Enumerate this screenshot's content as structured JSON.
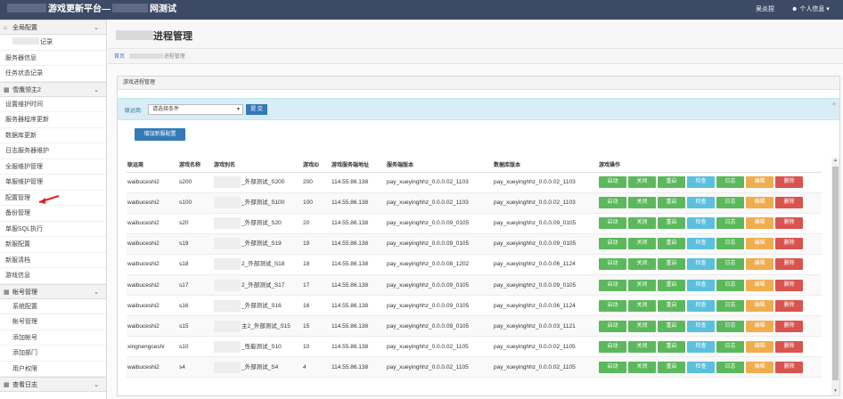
{
  "topbar": {
    "title_part1": "游戏更新平台—",
    "title_part2": "网测试",
    "user_name": "吴炎捏",
    "user_menu": "个人信息"
  },
  "sidebar": {
    "sections": [
      {
        "title": "全局配置",
        "icon": "home-icon",
        "items": [
          "记录",
          "服务器信息",
          "任务状态记录"
        ]
      },
      {
        "title": "雪鹰领主2",
        "icon": "grid-icon",
        "items": [
          "设置维护时间",
          "服务器程序更新",
          "数据库更新",
          "日志服务器维护",
          "全服维护管理",
          "单服维护管理",
          "配置管理",
          "备份管理",
          "单服SQL执行",
          "新服配置",
          "新服清档",
          "游戏信息"
        ]
      },
      {
        "title": "帐号管理",
        "icon": "grid-icon",
        "items": [
          "系统配置",
          "帐号管理",
          "添加帐号",
          "添加部门",
          "用户权限"
        ]
      },
      {
        "title": "查看日志",
        "icon": "grid-icon",
        "items": []
      }
    ]
  },
  "page": {
    "title": "进程管理",
    "breadcrumb_home": "首页",
    "breadcrumb_current": "进程管理"
  },
  "panel": {
    "heading": "游戏进程管理",
    "filter_label": "联运商:",
    "filter_select": "请选择条件",
    "query_button": "提 交",
    "add_button": "增加新服配置"
  },
  "table": {
    "headers": [
      "联运商",
      "游戏名称",
      "游戏别名",
      "游戏ID",
      "游戏服务端地址",
      "服务端版本",
      "数据库版本",
      "游戏操作"
    ],
    "rows": [
      [
        "waibuceshi2",
        "s200",
        "_外部测试_S200",
        "200",
        "114.55.86.138",
        "pay_xueyinghhz_0.0.0.02_1103",
        "pay_xueyinghhz_0.0.0.02_1103"
      ],
      [
        "waibuceshi2",
        "s100",
        "_外部测试_S100",
        "100",
        "114.55.86.138",
        "pay_xueyinghhz_0.0.0.02_1103",
        "pay_xueyinghhz_0.0.0.02_1103"
      ],
      [
        "waibuceshi2",
        "s20",
        "_外部测试_S20",
        "20",
        "114.55.86.138",
        "pay_xueyinghhz_0.0.0.09_0105",
        "pay_xueyinghhz_0.0.0.09_0105"
      ],
      [
        "waibuceshi2",
        "s19",
        "_外部测试_S19",
        "19",
        "114.55.86.138",
        "pay_xueyinghhz_0.0.0.09_0105",
        "pay_xueyinghhz_0.0.0.09_0105"
      ],
      [
        "waibuceshi2",
        "s18",
        "2_外部测试_S18",
        "18",
        "114.55.86.138",
        "pay_xueyinghhz_0.0.0.08_1202",
        "pay_xueyinghhz_0.0.0.06_1124"
      ],
      [
        "waibuceshi2",
        "s17",
        "2_外部测试_S17",
        "17",
        "114.55.86.138",
        "pay_xueyinghhz_0.0.0.09_0105",
        "pay_xueyinghhz_0.0.0.09_0105"
      ],
      [
        "waibuceshi2",
        "s16",
        "_外部测试_S16",
        "16",
        "114.55.86.138",
        "pay_xueyinghhz_0.0.0.09_0105",
        "pay_xueyinghhz_0.0.0.06_1124"
      ],
      [
        "waibuceshi2",
        "s15",
        "主2_外部测试_S15",
        "15",
        "114.55.86.138",
        "pay_xueyinghhz_0.0.0.09_0105",
        "pay_xueyinghhz_0.0.0.03_1121"
      ],
      [
        "xingnengceshi",
        "s10",
        "_性能测试_S10",
        "10",
        "114.55.86.138",
        "pay_xueyinghhz_0.0.0.02_1105",
        "pay_xueyinghhz_0.0.0.02_1105"
      ],
      [
        "waibuceshi2",
        "s4",
        "_外部测试_S4",
        "4",
        "114.55.86.138",
        "pay_xueyinghhz_0.0.0.02_1105",
        "pay_xueyinghhz_0.0.0.02_1105"
      ]
    ],
    "actions": [
      {
        "label": "启动",
        "color": "#5cb85c"
      },
      {
        "label": "关闭",
        "color": "#5cb85c"
      },
      {
        "label": "重启",
        "color": "#5cb85c"
      },
      {
        "label": "检查",
        "color": "#5bc0de"
      },
      {
        "label": "日志",
        "color": "#5cb85c"
      },
      {
        "label": "编辑",
        "color": "#f0ad4e"
      },
      {
        "label": "删除",
        "color": "#d9534f"
      }
    ]
  }
}
